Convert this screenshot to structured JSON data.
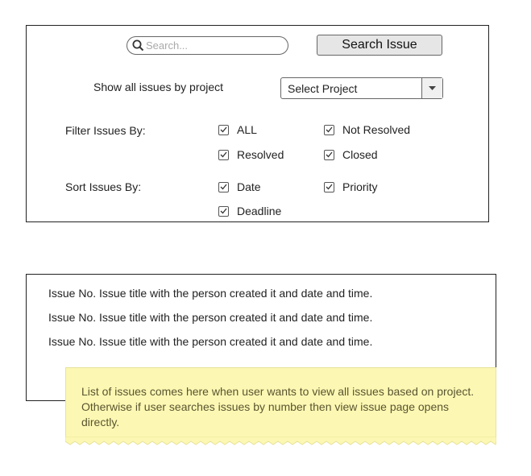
{
  "search": {
    "placeholder": "Search...",
    "button_label": "Search Issue"
  },
  "project": {
    "label": "Show all issues by project",
    "select_value": "Select Project"
  },
  "filter": {
    "label": "Filter Issues By:",
    "options": [
      {
        "label": "ALL",
        "checked": true
      },
      {
        "label": "Not Resolved",
        "checked": true
      },
      {
        "label": "Resolved",
        "checked": true
      },
      {
        "label": "Closed",
        "checked": true
      }
    ]
  },
  "sort": {
    "label": "Sort Issues By:",
    "options": [
      {
        "label": "Date",
        "checked": true
      },
      {
        "label": "Priority",
        "checked": true
      },
      {
        "label": "Deadline",
        "checked": true
      }
    ]
  },
  "issues": [
    "Issue No. Issue title with the person created it and date and time.",
    "Issue No. Issue title with the person created it and date and time.",
    "Issue No. Issue title with the person created it and date and time."
  ],
  "note": {
    "text": "List of issues comes here when user wants to view all issues based on project. Otherwise if user searches issues by number then view issue page opens directly.",
    "color": "#fcf8b3"
  },
  "icons": {
    "search": "search-icon",
    "dropdown": "chevron-down-icon",
    "check": "check-icon"
  }
}
